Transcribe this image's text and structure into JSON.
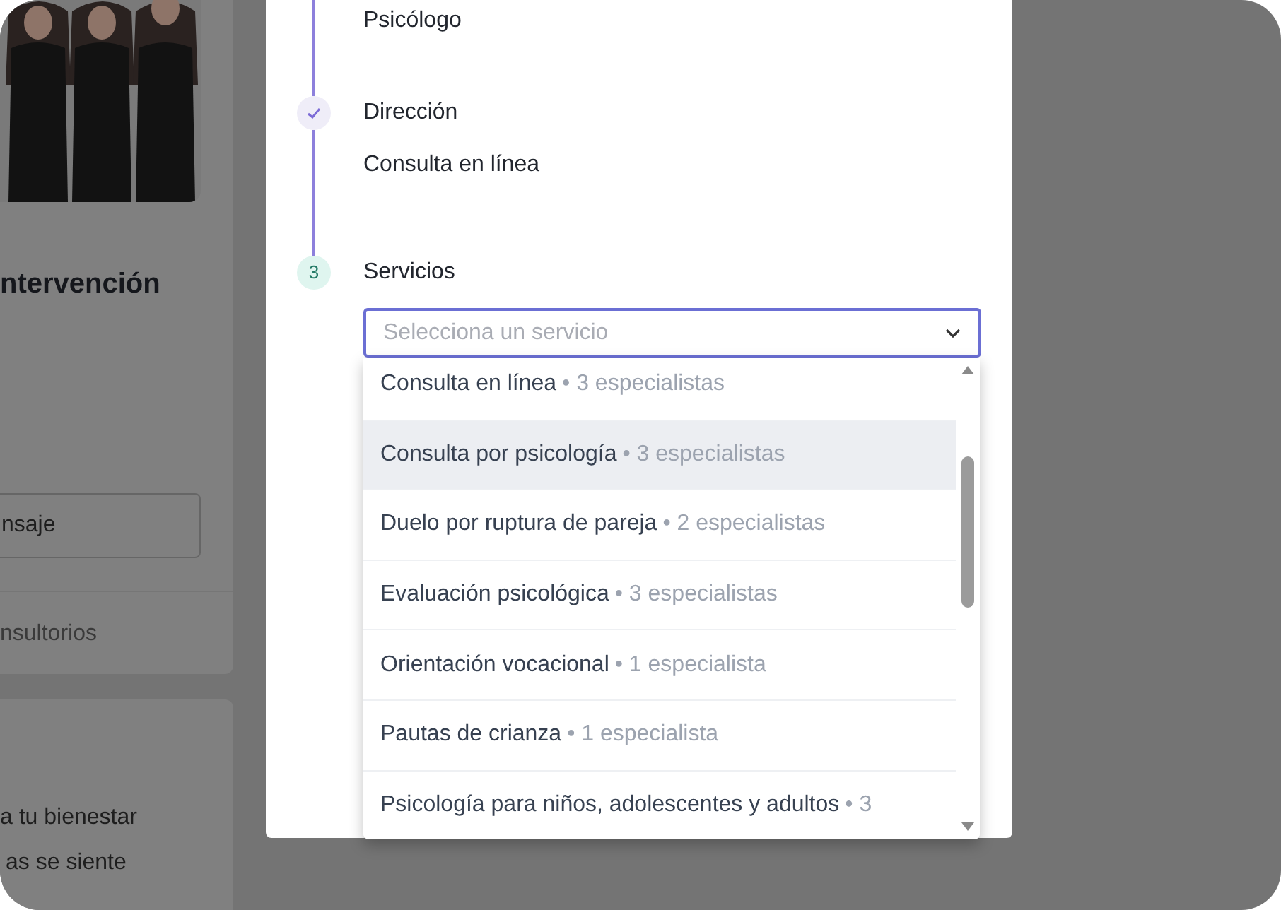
{
  "background_page": {
    "profile_card": {
      "title": "ntervención",
      "message_button": "nsaje",
      "offices_link": "nsultorios"
    },
    "info_card": {
      "lines": [
        "a tu bienestar",
        "as se siente"
      ]
    }
  },
  "booking_modal": {
    "steps": [
      {
        "values": [
          "Psicólogo"
        ]
      },
      {
        "completed": true,
        "title": "Dirección",
        "values": [
          "Consulta en línea"
        ]
      },
      {
        "completed": false,
        "number": "3",
        "title": "Servicios"
      }
    ],
    "service_select": {
      "placeholder": "Selecciona un servicio",
      "open": true,
      "options": [
        {
          "name": "Consulta en línea",
          "count": "• 3 especialistas",
          "highlighted": false
        },
        {
          "name": "Consulta por psicología",
          "count": "• 3 especialistas",
          "highlighted": true
        },
        {
          "name": "Duelo por ruptura de pareja",
          "count": "• 2 especialistas",
          "highlighted": false
        },
        {
          "name": "Evaluación psicológica",
          "count": "• 3 especialistas",
          "highlighted": false
        },
        {
          "name": "Orientación vocacional",
          "count": "• 1 especialista",
          "highlighted": false
        },
        {
          "name": "Pautas de crianza",
          "count": "• 1 especialista",
          "highlighted": false
        },
        {
          "name": "Psicología para niños, adolescentes y adultos",
          "count": "• 3",
          "highlighted": false
        }
      ]
    }
  }
}
